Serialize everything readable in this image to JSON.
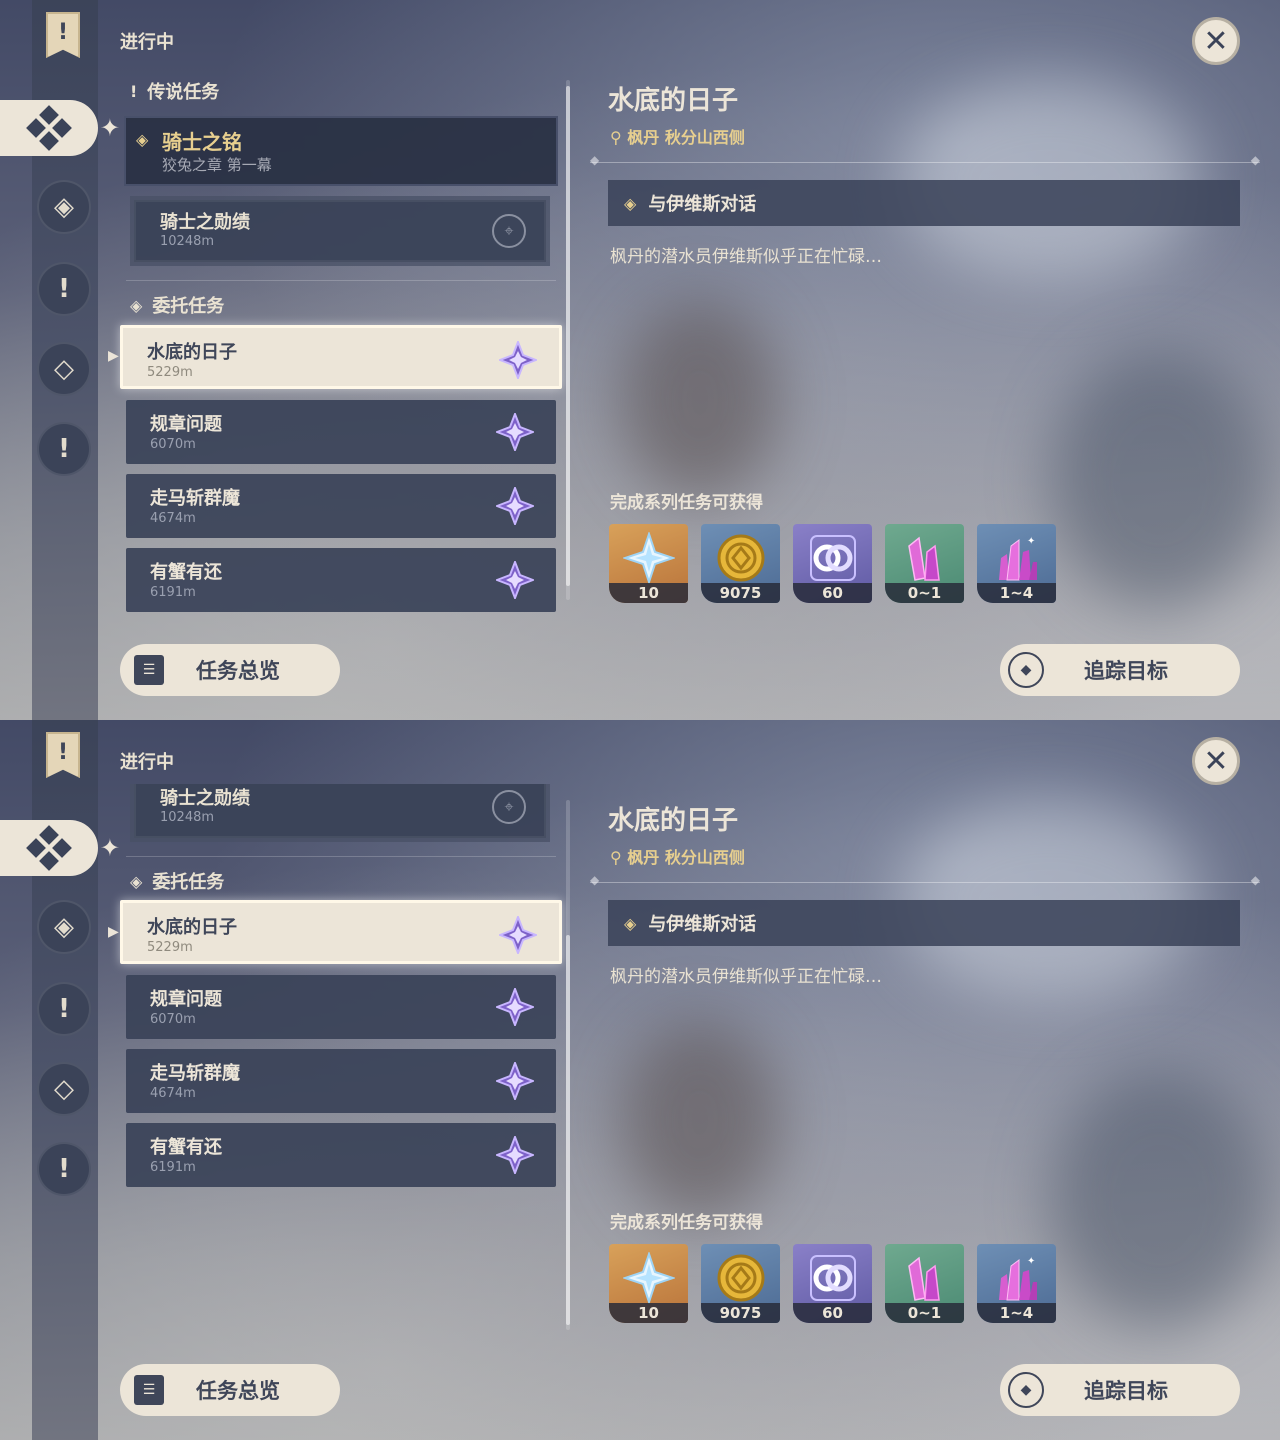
{
  "status_label": "进行中",
  "categories": {
    "legend": "传说任务",
    "commission": "委托任务"
  },
  "legend_quest": {
    "title": "骑士之铭",
    "subtitle": "狡兔之章 第一幕"
  },
  "legend_subquest": {
    "title": "骑士之勋绩",
    "distance": "10248m"
  },
  "commissions": [
    {
      "title": "水底的日子",
      "distance": "5229m"
    },
    {
      "title": "规章问题",
      "distance": "6070m"
    },
    {
      "title": "走马斩群魔",
      "distance": "4674m"
    },
    {
      "title": "有蟹有还",
      "distance": "6191m"
    }
  ],
  "detail": {
    "title": "水底的日子",
    "location": "枫丹 秋分山西侧",
    "objective": "与伊维斯对话",
    "description": "枫丹的潜水员伊维斯似乎正在忙碌…",
    "rewards_label": "完成系列任务可获得",
    "rewards": [
      {
        "icon": "primogem-icon",
        "count": "10"
      },
      {
        "icon": "mora-icon",
        "count": "9075"
      },
      {
        "icon": "fellowship-icon",
        "count": "60"
      },
      {
        "icon": "crystal-icon",
        "count": "0~1"
      },
      {
        "icon": "crystal-cluster-icon",
        "count": "1~4"
      }
    ]
  },
  "buttons": {
    "overview": "任务总览",
    "track": "追踪目标"
  },
  "colors": {
    "accent_gold": "#e7cf8f",
    "panel_dark": "#3a4258",
    "cream": "#ece5d8"
  }
}
